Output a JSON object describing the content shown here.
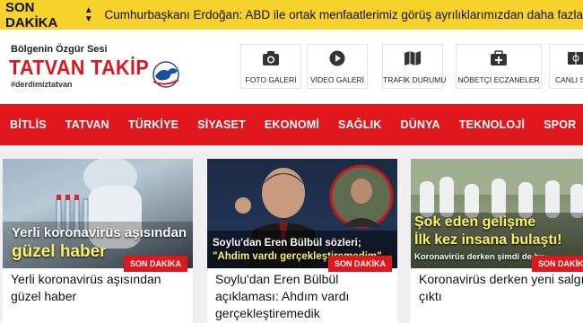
{
  "ticker": {
    "label": "SON DAKİKA",
    "text": "Cumhurbaşkanı Erdoğan: ABD ile ortak menfaatlerimiz görüş ayrılıklarımızdan daha fazla"
  },
  "logo": {
    "tagline": "Bölgenin Özgür Sesi",
    "title": "TATVAN TAKİP",
    "hashtag": "#derdimiztatvan"
  },
  "quick_links": [
    {
      "label": "FOTO GALERİ",
      "icon": "camera-icon"
    },
    {
      "label": "VİDEO GALERİ",
      "icon": "play-icon"
    },
    {
      "label": "TRAFİK DURUMU",
      "icon": "map-icon"
    },
    {
      "label": "NÖBETÇİ ECZANELER",
      "icon": "pharmacy-icon"
    },
    {
      "label": "CANLI SKOR",
      "icon": "score-icon"
    }
  ],
  "nav": [
    "BİTLİS",
    "TATVAN",
    "TÜRKİYE",
    "SİYASET",
    "EKONOMİ",
    "SAĞLIK",
    "DÜNYA",
    "TEKNOLOJİ",
    "SPOR"
  ],
  "cards": [
    {
      "image_text_line1": "Yerli koronavirüs aşısından",
      "image_text_line2": "güzel haber",
      "badge": "SON DAKİKA",
      "headline": "Yerli koronavirüs aşısından güzel haber"
    },
    {
      "image_text_line1": "Soylu'dan Eren Bülbül sözleri;",
      "image_text_line2": "\"Ahdim vardı gerçekleştiremedim\"",
      "badge": "SON DAKİKA",
      "headline": "Soylu'dan Eren Bülbül açıklaması: Ahdım vardı gerçekleştiremedik"
    },
    {
      "image_text_line1": "Şok eden gelişme",
      "image_text_line2": "İlk kez insana bulaştı!",
      "image_text_line3": "Koronavirüs derken şimdi de bu...",
      "badge": "SON DAKİKA",
      "headline": "Koronavirüs derken yeni salgın çıktı"
    }
  ],
  "colors": {
    "accent": "#e0171d",
    "ticker": "#f6d22a"
  }
}
